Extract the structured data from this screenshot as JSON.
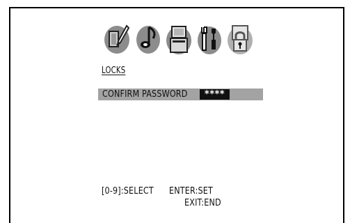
{
  "menu": {
    "icons": [
      {
        "name": "picture-settings-icon",
        "color": "#8a8a8a"
      },
      {
        "name": "audio-settings-icon",
        "color": "#8a8a8a"
      },
      {
        "name": "disc-setup-icon",
        "color": "#8a8a8a"
      },
      {
        "name": "tools-icon",
        "color": "#8a8a8a"
      },
      {
        "name": "lock-icon",
        "color": "#a8a8a8",
        "selected": true
      }
    ],
    "title": "LOCKS"
  },
  "password": {
    "label": "CONFIRM PASSWORD",
    "value": "****"
  },
  "hints": {
    "select": "[0-9]:SELECT",
    "set": "ENTER:SET",
    "exit": "EXIT:END"
  },
  "colors": {
    "background": "#ffffff",
    "highlight_bar": "#a3a3a3",
    "input_box": "#111111",
    "text": "#111111"
  }
}
